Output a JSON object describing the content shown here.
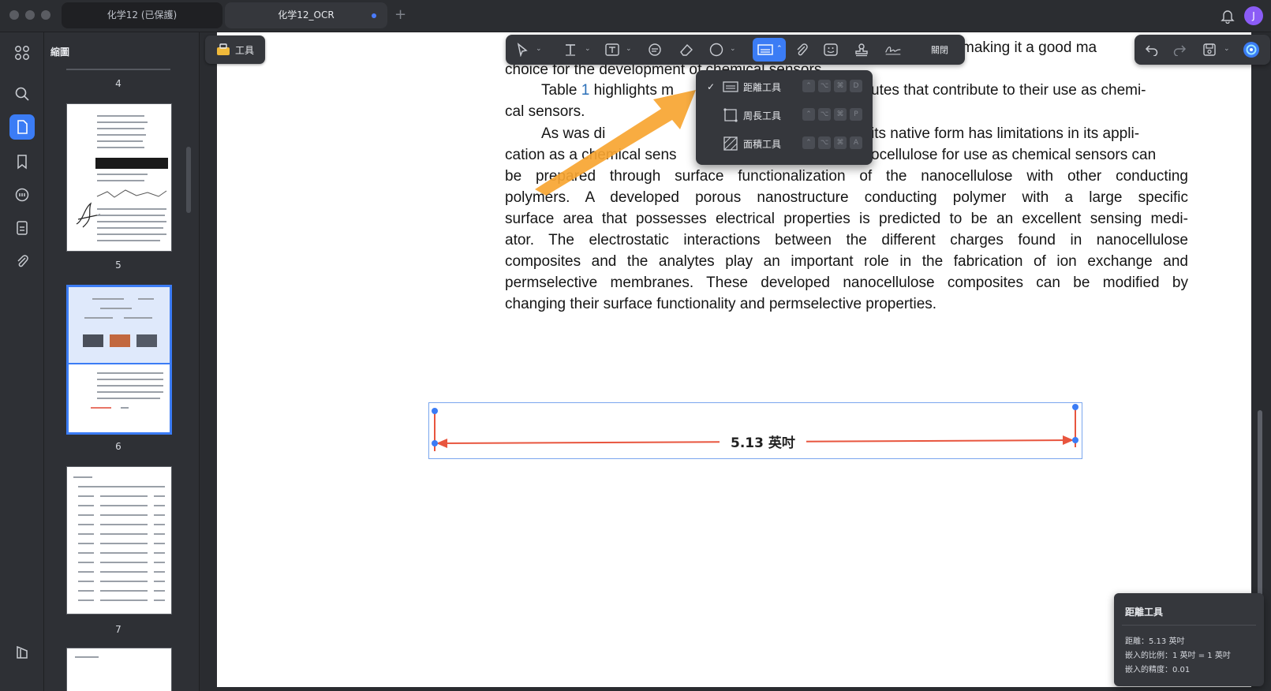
{
  "tabs": [
    {
      "label": "化学12 (已保護)"
    },
    {
      "label": "化学12_OCR"
    }
  ],
  "user": {
    "avatar_initial": "J"
  },
  "sidebar": {
    "title": "縮圖"
  },
  "thumbnails": {
    "page_numbers": [
      "4",
      "5",
      "6",
      "7"
    ]
  },
  "tools_button": {
    "label": "工具"
  },
  "toolbar": {
    "close_label": "關閉"
  },
  "document": {
    "line_top": "making it a good ma",
    "line_1": "choice for the development of chemical sensors.",
    "p2_start": "Table",
    "p2_ref": "1",
    "p2_mid": "highlights m",
    "p2_end": "utes that contribute to their use as chemi-",
    "line_3": "cal sensors.",
    "p3_a": "As was di",
    "p3_b": "its native form has limitations in its appli-",
    "line_5a": "cation as a chemical sens",
    "line_5b": "ocellulose for use as chemical sensors can",
    "line_6": "be prepared through surface functionalization of the nanocellulose with other conducting",
    "line_7": "polymers. A developed porous nanostructure conducting polymer with a large specific",
    "line_8": "surface area that possesses electrical properties is predicted to be an excellent sensing medi-",
    "line_9": "ator. The electrostatic interactions between the different charges found in nanocellulose",
    "line_10": "composites and the analytes play an important role in the fabrication of ion exchange and",
    "line_11": "permselective membranes. These developed nanocellulose composites can be modified by",
    "line_12": "changing their surface functionality and permselective properties."
  },
  "measure_menu": {
    "items": [
      {
        "label": "距離工具",
        "checked": "✓",
        "shortcut_last": "D"
      },
      {
        "label": "周長工具",
        "checked": "",
        "shortcut_last": "P"
      },
      {
        "label": "面積工具",
        "checked": "",
        "shortcut_last": "A"
      }
    ]
  },
  "measurement": {
    "label": "5.13 英吋"
  },
  "info_panel": {
    "title": "距離工具",
    "distance": "距離：5.13 英吋",
    "scale": "嵌入的比例：1 英吋 = 1 英吋",
    "precision": "嵌入的精度：0.01"
  },
  "colors": {
    "accent": "#3b7cf5",
    "arrow_annotation": "#f7a531",
    "measure_line": "#e8553e",
    "dark_bg": "#2e3035"
  }
}
